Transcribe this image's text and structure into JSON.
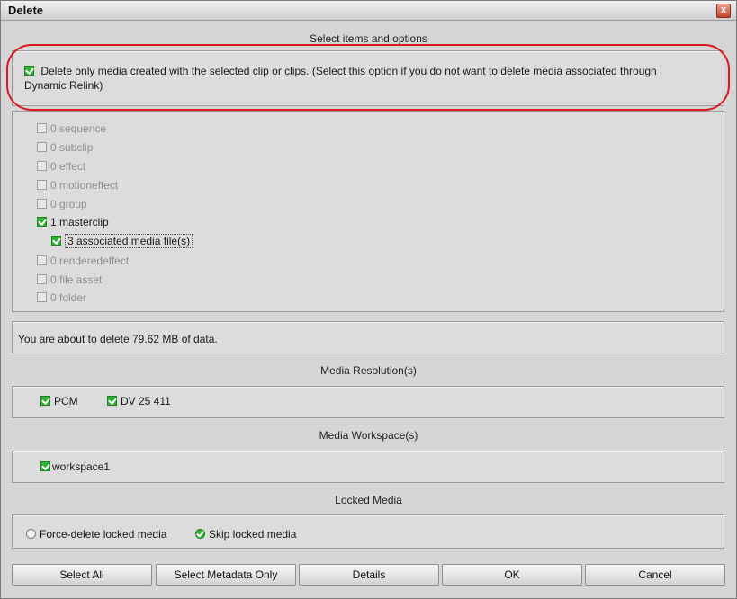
{
  "window": {
    "title": "Delete",
    "close_label": "x"
  },
  "sections": {
    "select_items": "Select items and options",
    "media_resolution": "Media Resolution(s)",
    "media_workspace": "Media Workspace(s)",
    "locked_media": "Locked Media"
  },
  "option": {
    "label_line1": "Delete only media created with the selected clip or clips. (Select this option if you do not want to delete media associated through",
    "label_line2": "Dynamic Relink)",
    "checked": true
  },
  "items": [
    {
      "label": "0 sequence",
      "checked": false,
      "enabled": false
    },
    {
      "label": "0 subclip",
      "checked": false,
      "enabled": false
    },
    {
      "label": "0 effect",
      "checked": false,
      "enabled": false
    },
    {
      "label": "0 motioneffect",
      "checked": false,
      "enabled": false
    },
    {
      "label": "0 group",
      "checked": false,
      "enabled": false
    },
    {
      "label": "1 masterclip",
      "checked": true,
      "enabled": true
    },
    {
      "label": "3 associated media file(s)",
      "checked": true,
      "enabled": true
    },
    {
      "label": "0 renderedeffect",
      "checked": false,
      "enabled": false
    },
    {
      "label": "0 file asset",
      "checked": false,
      "enabled": false
    },
    {
      "label": "0 folder",
      "checked": false,
      "enabled": false
    }
  ],
  "summary": "You are about to delete 79.62 MB of data.",
  "resolutions": [
    {
      "label": "PCM",
      "checked": true
    },
    {
      "label": "DV 25 411",
      "checked": true
    }
  ],
  "workspaces": [
    {
      "label": "workspace1",
      "checked": true
    }
  ],
  "locked": {
    "force_delete": "Force-delete locked media",
    "skip": "Skip locked media",
    "selected": "skip"
  },
  "buttons": {
    "select_all": "Select All",
    "select_metadata": "Select Metadata Only",
    "details": "Details",
    "ok": "OK",
    "cancel": "Cancel"
  },
  "colors": {
    "highlight": "#d8191f",
    "check_green": "#2fb335"
  }
}
